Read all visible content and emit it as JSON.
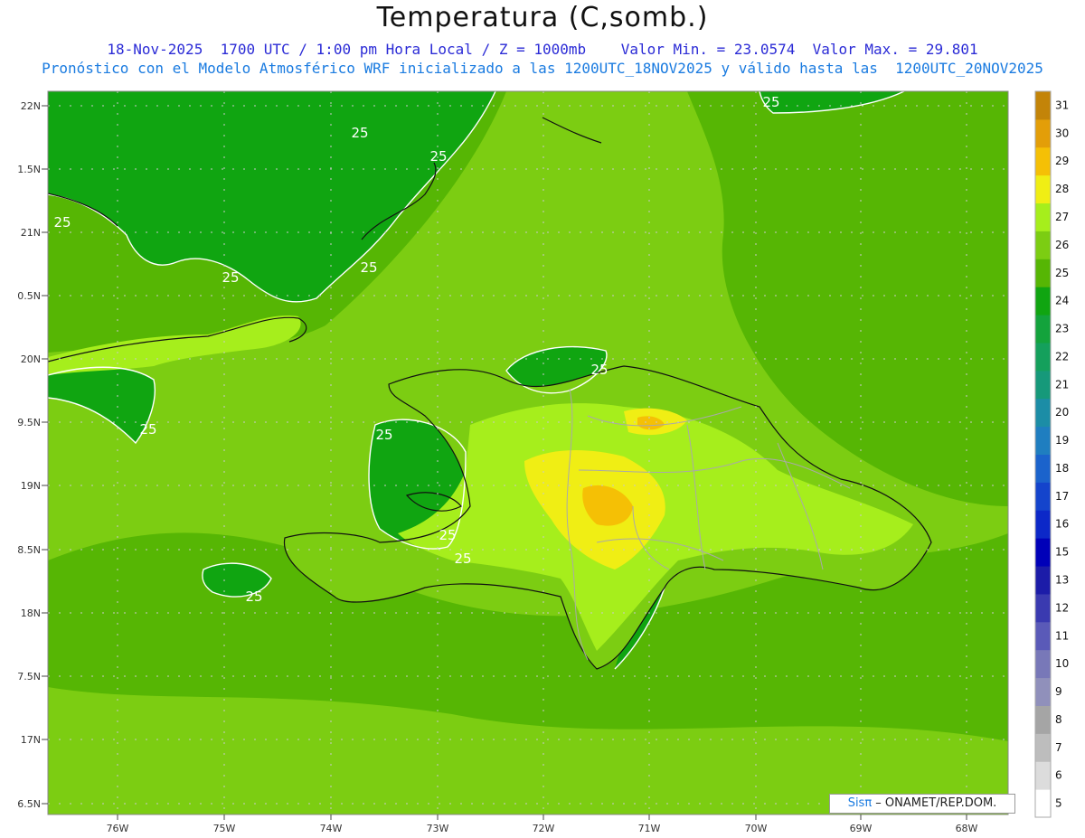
{
  "header": {
    "title": "Temperatura (C,somb.)",
    "line2": "18-Nov-2025  1700 UTC / 1:00 pm Hora Local / Z = 1000mb    Valor Min. = 23.0574  Valor Max. = 29.801",
    "line3": "Pronóstico con el Modelo Atmosférico WRF inicializado a las 1200UTC_18NOV2025 y válido hasta las  1200UTC_20NOV2025"
  },
  "map": {
    "lat_ticks": [
      "22N",
      "21.5N",
      "21N",
      "20.5N",
      "20N",
      "19.5N",
      "19N",
      "18.5N",
      "18N",
      "17.5N",
      "17N",
      "16.5N"
    ],
    "lat_tick_labels": [
      "22N",
      "1.5N",
      "21N",
      "0.5N",
      "20N",
      "9.5N",
      "19N",
      "8.5N",
      "18N",
      "7.5N",
      "17N",
      "6.5N"
    ],
    "lon_tick_labels": [
      "76W",
      "75W",
      "74W",
      "73W",
      "72W",
      "71W",
      "70W",
      "69W",
      "68W"
    ],
    "contour_labels": [
      "25",
      "25",
      "25",
      "25",
      "25",
      "25",
      "25",
      "25",
      "25",
      "25",
      "25",
      "25"
    ],
    "field_colors": {
      "c24": "#10a511",
      "c25": "#56b604",
      "c26": "#7ccd12",
      "c27": "#a6ee1c",
      "c28": "#f0ee14",
      "c29": "#f5c005"
    }
  },
  "colorbar": {
    "values": [
      "5",
      "6",
      "7",
      "8",
      "9",
      "10",
      "11",
      "12",
      "13",
      "15",
      "16",
      "17",
      "18",
      "19",
      "20",
      "21",
      "22",
      "23",
      "24",
      "25",
      "26",
      "27",
      "28",
      "29",
      "30",
      "31"
    ],
    "colors": [
      "#ffffff",
      "#dcdcdc",
      "#bdbdbd",
      "#a5a5a5",
      "#9090bb",
      "#7878b8",
      "#5a5ab8",
      "#3a3ab0",
      "#1c1ca8",
      "#0000b8",
      "#0c28c8",
      "#1444cc",
      "#1b63cc",
      "#1f7ec0",
      "#1c8da6",
      "#16997a",
      "#14a05c",
      "#13a33c",
      "#10a511",
      "#56b604",
      "#7ccd12",
      "#a6ee1c",
      "#f0ee14",
      "#f5c005",
      "#e39e08",
      "#c38408"
    ]
  },
  "credit": {
    "brand": "Sisπ",
    "text": " – ONAMET/REP.DOM."
  }
}
